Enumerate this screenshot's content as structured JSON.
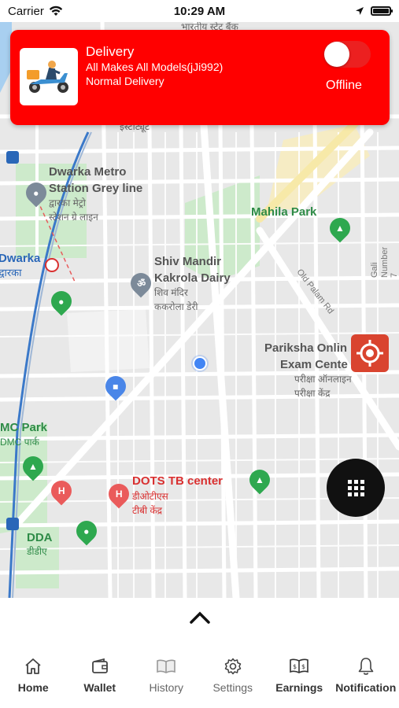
{
  "status_bar": {
    "carrier": "Carrier",
    "time": "10:29 AM"
  },
  "status_card": {
    "title": "Delivery",
    "vehicle": "All Makes All Models(jJi992)",
    "delivery_type": "Normal Delivery",
    "online_toggle": false,
    "status_label": "Offline",
    "background": "#ff0000"
  },
  "map": {
    "labels": {
      "dwarka_metro_line1": "Dwarka Metro",
      "dwarka_metro_line2": "Station Grey line",
      "dwarka_metro_hi1": "द्वारका मेट्रो",
      "dwarka_metro_hi2": "स्टेशन ग्रे लाइन",
      "dwarka": "Dwarka",
      "dwarka_hi": "द्वारका",
      "institute_hi": "इंस्टीट्यूट",
      "top_hi": "भारतीय स्टेट बैंक",
      "mahila_park": "Mahila Park",
      "gali_number": "Gali Number 7",
      "old_palam": "Old Palam Rd",
      "shiv_mandir1": "Shiv Mandir",
      "shiv_mandir2": "Kakrola Dairy",
      "shiv_mandir_hi1": "शिव मंदिर",
      "shiv_mandir_hi2": "ककरोला डेरी",
      "pariksha1": "Pariksha Onlin",
      "pariksha2": "Exam Cente",
      "pariksha_hi1": "परीक्षा ऑनलाइन",
      "pariksha_hi2": "परीक्षा केंद्र",
      "dmc_park": "MC Park",
      "dmc_park_hi": "DMC पार्क",
      "dots1": "DOTS TB center",
      "dots_hi1": "डीओटीएस",
      "dots_hi2": "टीबी केंद्र",
      "dda": "DDA",
      "dda_hi": "डीडीए"
    }
  },
  "tabs": [
    {
      "label": "Home",
      "icon": "home-icon"
    },
    {
      "label": "Wallet",
      "icon": "wallet-icon"
    },
    {
      "label": "History",
      "icon": "book-icon"
    },
    {
      "label": "Settings",
      "icon": "gear-icon"
    },
    {
      "label": "Earnings",
      "icon": "earnings-icon"
    },
    {
      "label": "Notification",
      "icon": "bell-icon"
    }
  ]
}
